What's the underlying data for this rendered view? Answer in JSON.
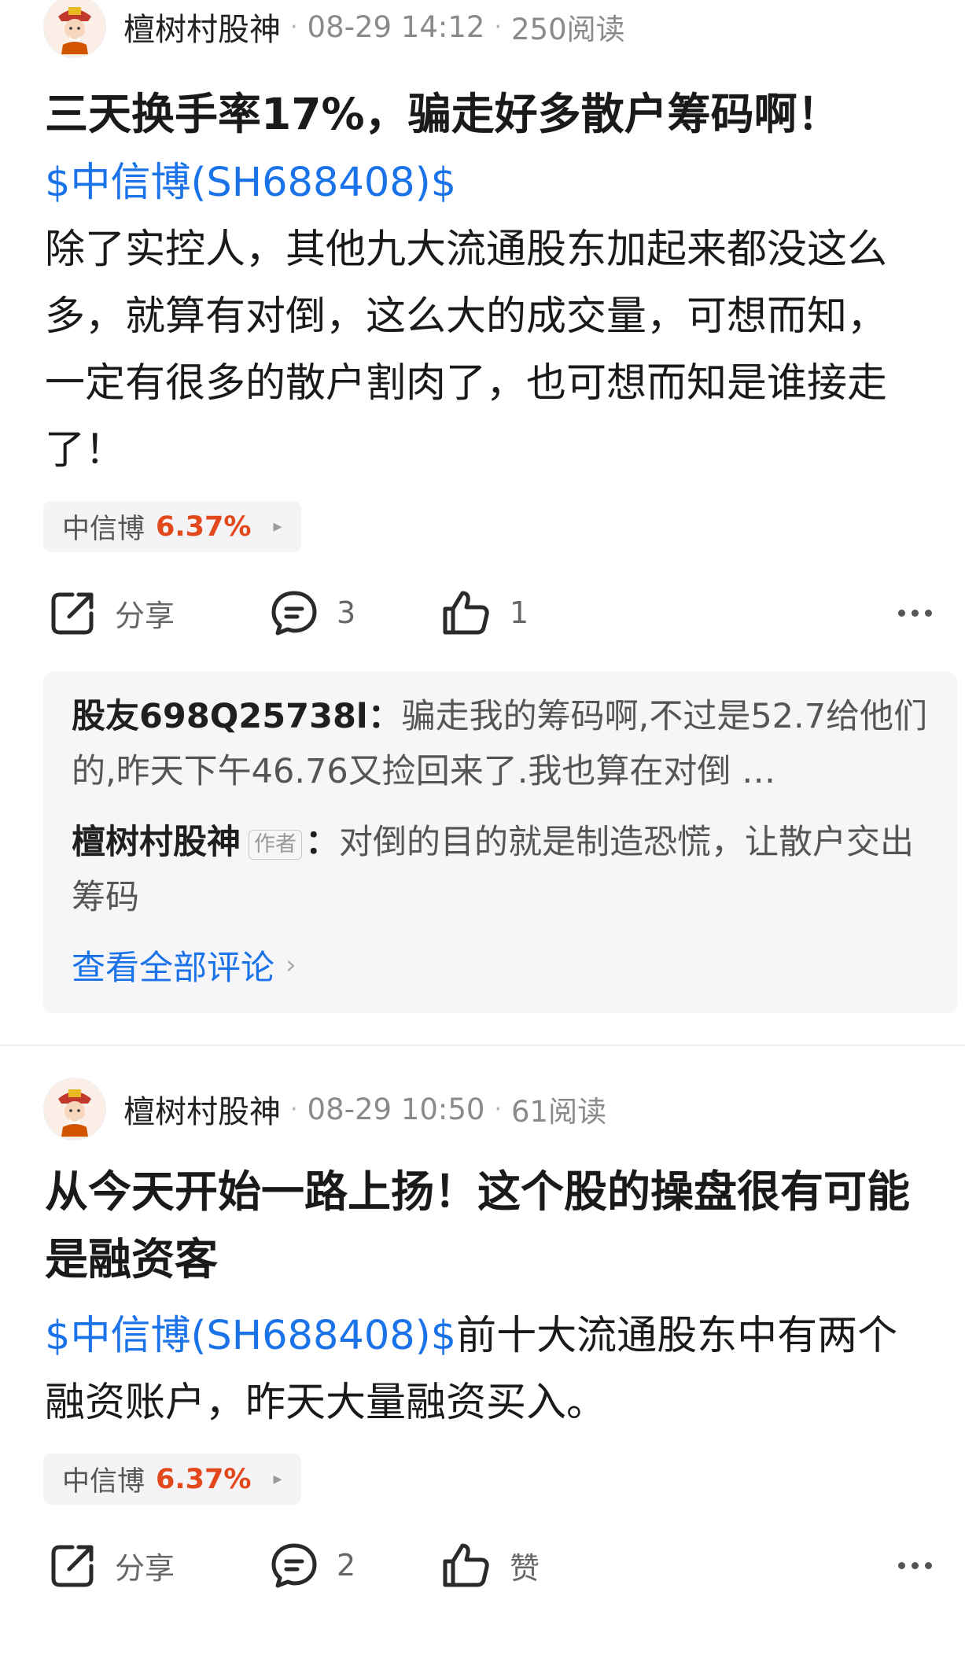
{
  "colors": {
    "link": "#1a73e8",
    "up": "#e2481b"
  },
  "posts": [
    {
      "author": "檀树村股神",
      "time": "08-29 14:12",
      "reads": "250阅读",
      "title": "三天换手率17%，骗走好多散户筹码啊！",
      "stock_link": "$中信博(SH688408)$",
      "body_text": "除了实控人，其他九大流通股东加起来都没这么多，就算有对倒，这么大的成交量，可想而知，一定有很多的散户割肉了，也可想而知是谁接走了！",
      "chip": {
        "name": "中信博",
        "pct": "6.37%",
        "arrow": "▸"
      },
      "actions": {
        "share": "分享",
        "comments": "3",
        "likes": "1"
      },
      "comments": [
        {
          "who": "股友698Q25738l",
          "sep": "：",
          "text": "骗走我的筹码啊,不过是52.7给他们的,昨天下午46.76又捡回来了.我也算在对倒 …"
        },
        {
          "who": "檀树村股神",
          "badge": "作者",
          "sep": "：",
          "text": "对倒的目的就是制造恐慌，让散户交出筹码"
        }
      ],
      "view_all": "查看全部评论"
    },
    {
      "author": "檀树村股神",
      "time": "08-29 10:50",
      "reads": "61阅读",
      "title": "从今天开始一路上扬！这个股的操盘很有可能是融资客",
      "stock_link": "$中信博(SH688408)$",
      "body_text": "前十大流通股东中有两个融资账户，昨天大量融资买入。",
      "chip": {
        "name": "中信博",
        "pct": "6.37%",
        "arrow": "▸"
      },
      "actions": {
        "share": "分享",
        "comments": "2",
        "likes": "赞"
      }
    }
  ],
  "icons": [
    "avatar-icon",
    "share-icon",
    "comment-icon",
    "like-icon",
    "more-icon",
    "chevron-right-icon"
  ]
}
